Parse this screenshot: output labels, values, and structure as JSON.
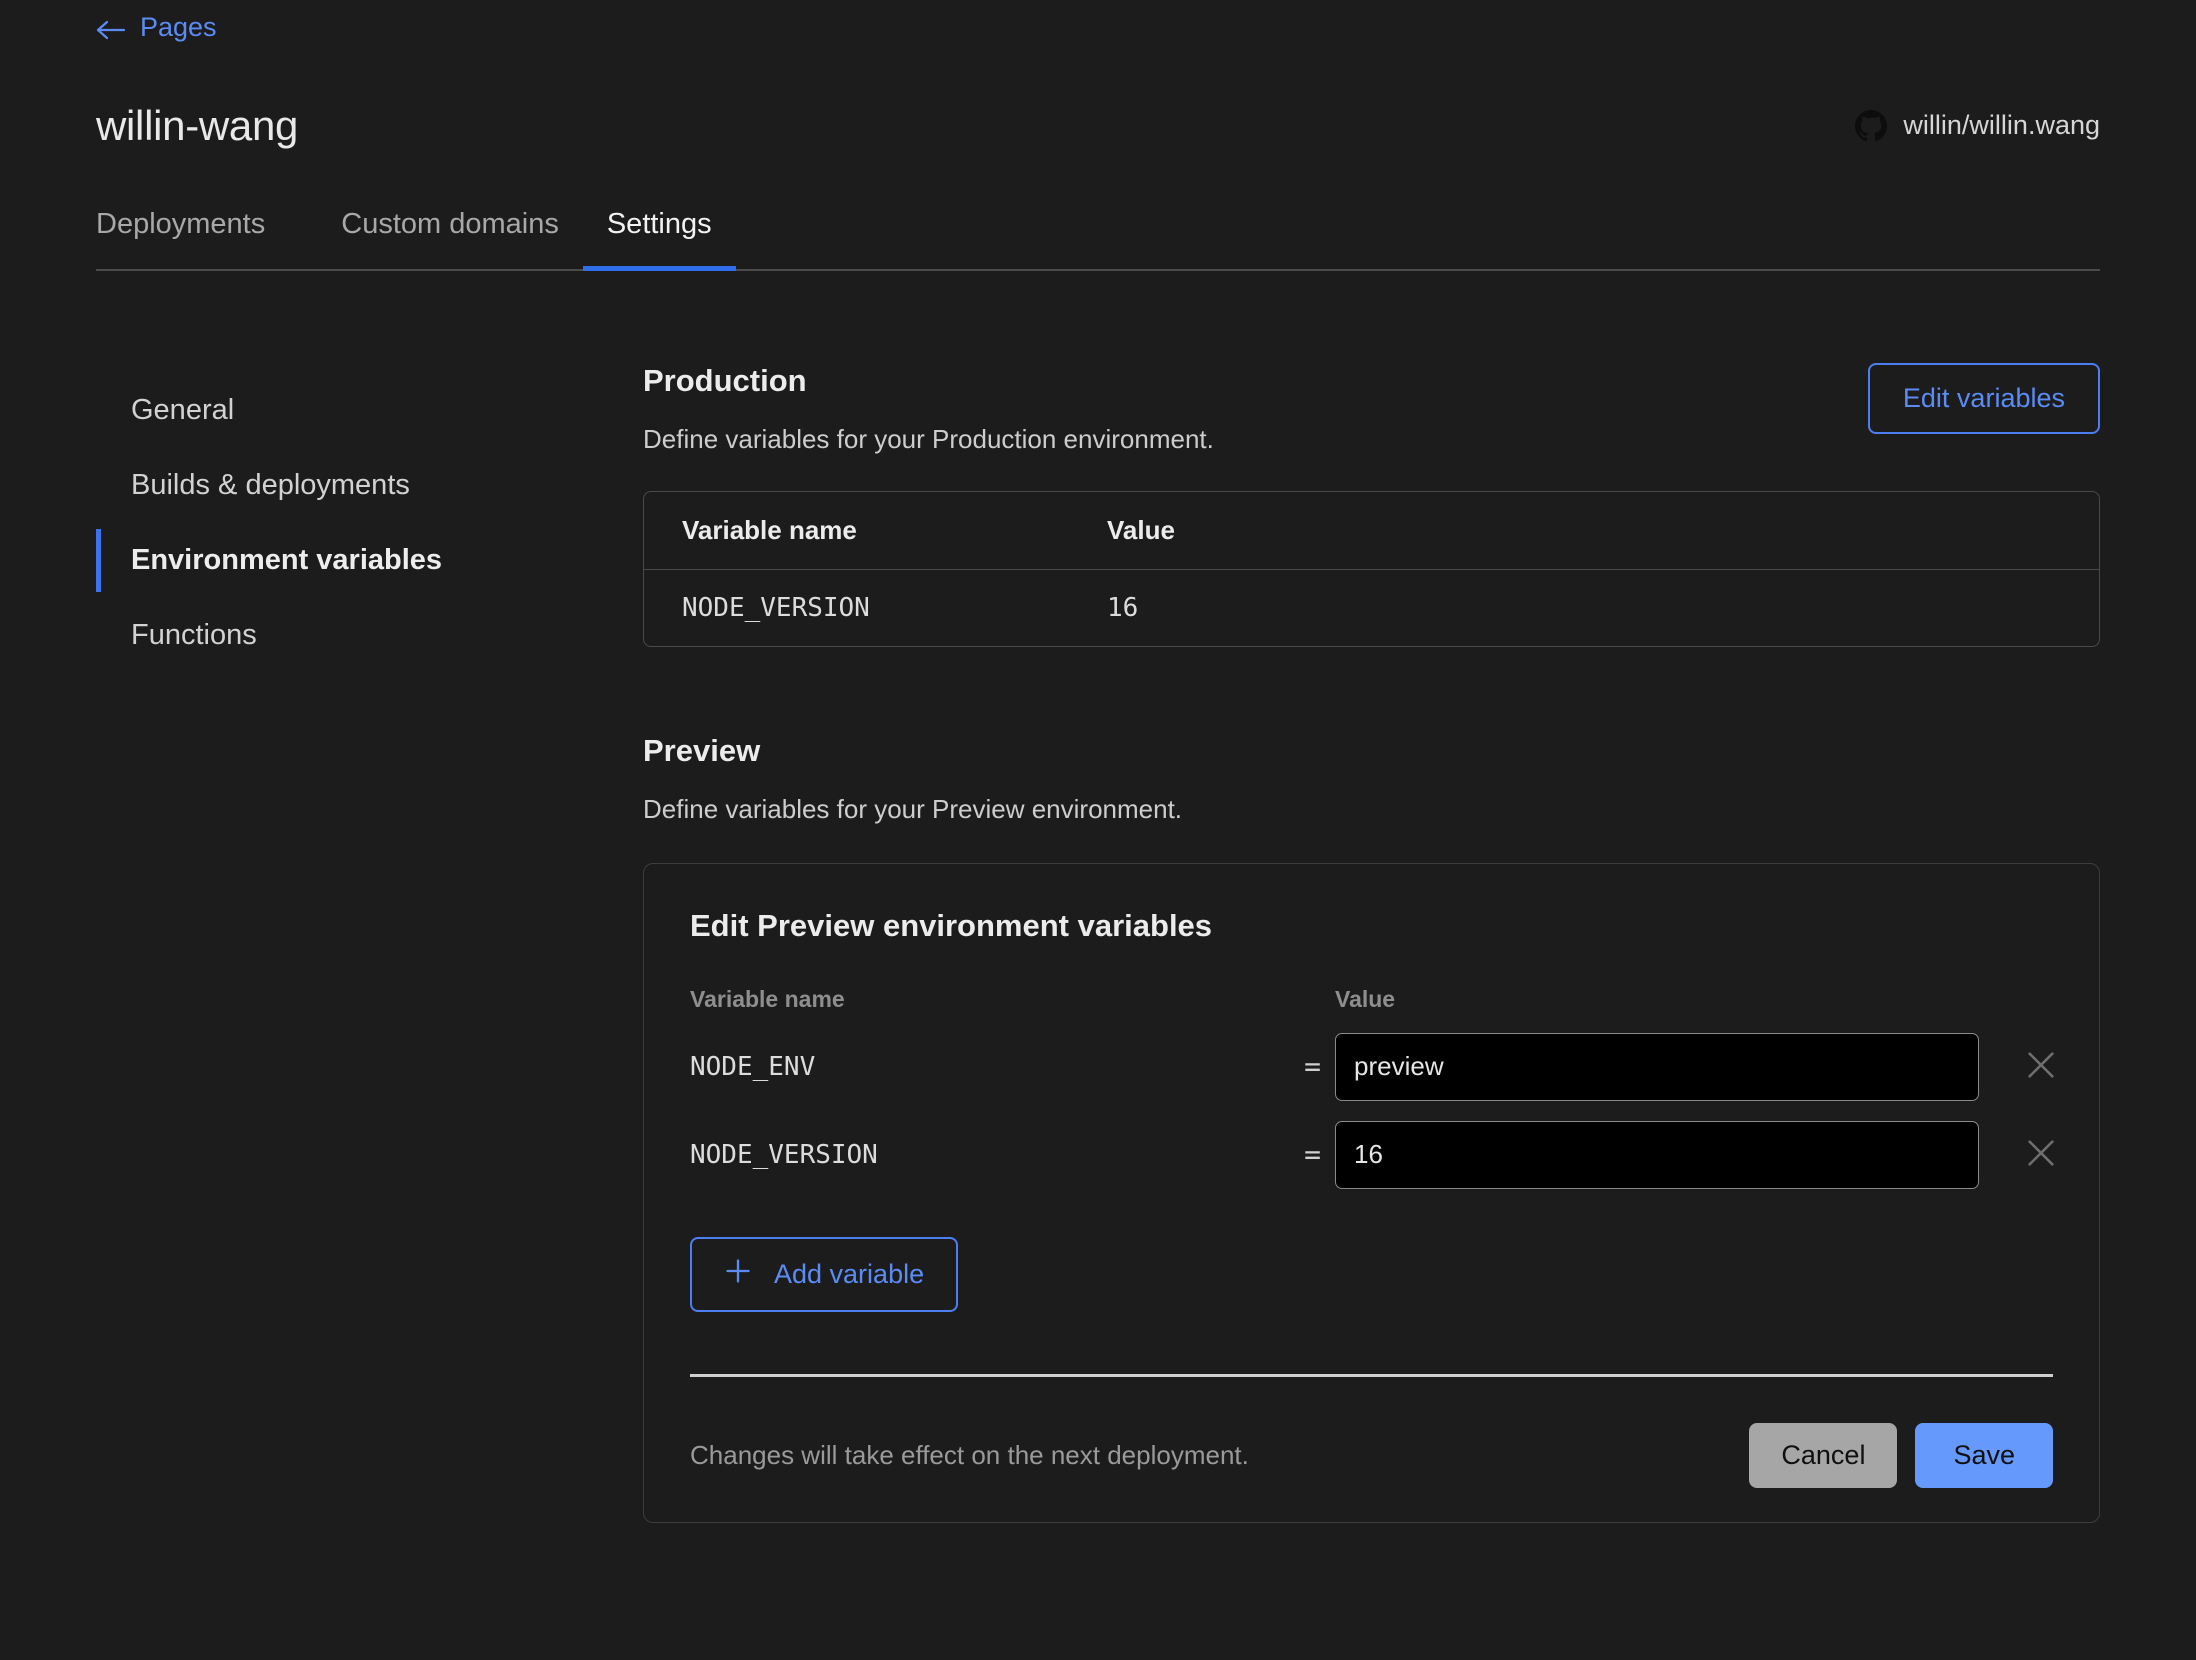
{
  "back": {
    "label": "Pages",
    "icon": "arrow-left-icon"
  },
  "header": {
    "project_title": "willin-wang",
    "repo": {
      "label": "willin/willin.wang",
      "icon": "github-icon"
    }
  },
  "tabs": [
    {
      "label": "Deployments",
      "active": false
    },
    {
      "label": "Custom domains",
      "active": false
    },
    {
      "label": "Settings",
      "active": true
    }
  ],
  "sidebar": {
    "items": [
      {
        "label": "General",
        "active": false
      },
      {
        "label": "Builds & deployments",
        "active": false
      },
      {
        "label": "Environment variables",
        "active": true
      },
      {
        "label": "Functions",
        "active": false
      }
    ]
  },
  "production": {
    "title": "Production",
    "description": "Define variables for your Production environment.",
    "edit_button": "Edit variables",
    "columns": [
      "Variable name",
      "Value"
    ],
    "rows": [
      {
        "name": "NODE_VERSION",
        "value": "16"
      }
    ]
  },
  "preview": {
    "title": "Preview",
    "description": "Define variables for your Preview environment.",
    "panel": {
      "title": "Edit Preview environment variables",
      "columns": [
        "Variable name",
        "Value"
      ],
      "equals": "=",
      "rows": [
        {
          "name": "NODE_ENV",
          "value": "preview",
          "placeholder": "",
          "delete_icon": "close-icon"
        },
        {
          "name": "NODE_VERSION",
          "value": "16",
          "placeholder": "",
          "delete_icon": "close-icon"
        }
      ],
      "add_button": {
        "label": "Add variable",
        "icon": "plus-icon"
      },
      "footer_note": "Changes will take effect on the next deployment.",
      "cancel_label": "Cancel",
      "save_label": "Save"
    }
  },
  "colors": {
    "background": "#1c1c1c",
    "accent_blue": "#5b8cf5",
    "tab_underline": "#2f6fec",
    "save_blue": "#6699fc",
    "cancel_gray": "#a6a6a6"
  }
}
